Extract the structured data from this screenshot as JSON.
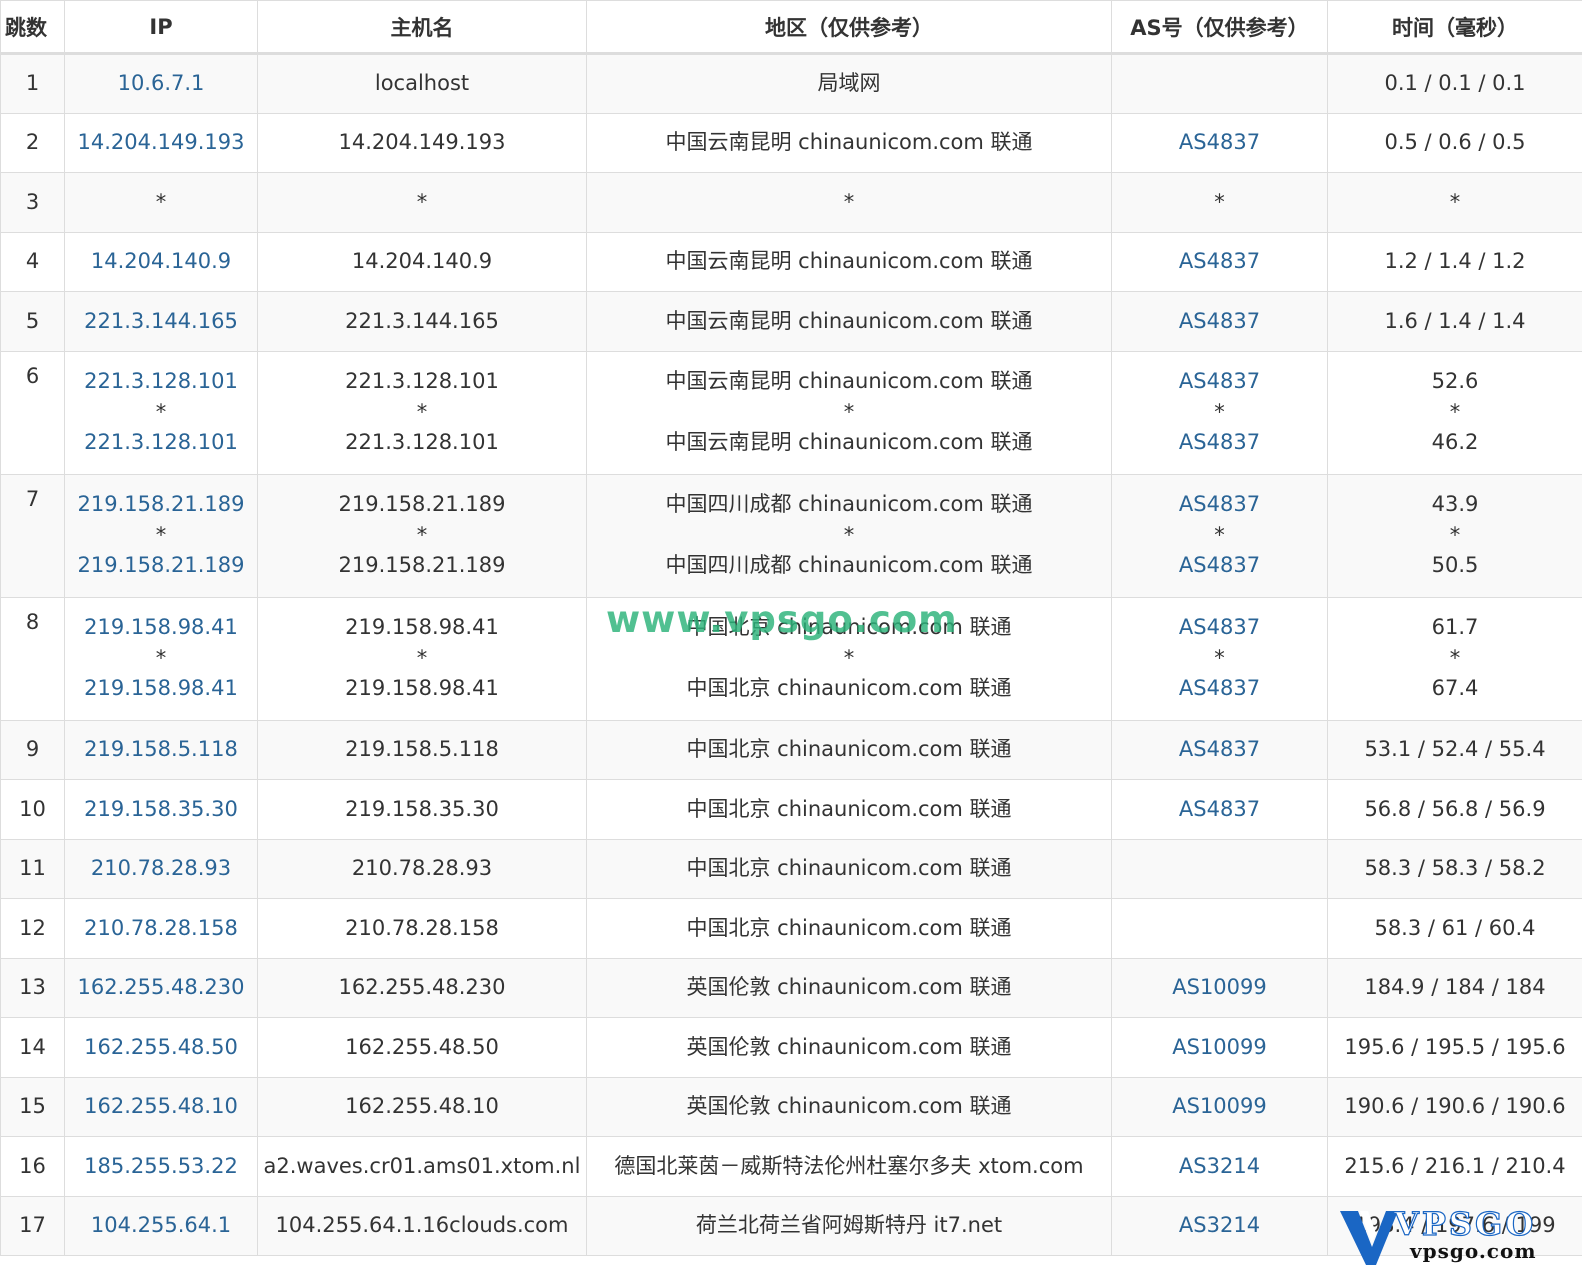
{
  "headers": [
    "跳数",
    "IP",
    "主机名",
    "地区（仅供参考）",
    "AS号（仅供参考）",
    "时间（毫秒）"
  ],
  "hops": [
    {
      "hop": "1",
      "ip": [
        "10.6.7.1"
      ],
      "host": [
        "localhost"
      ],
      "region": [
        "局域网"
      ],
      "as": [
        ""
      ],
      "time": [
        "0.1 / 0.1 / 0.1"
      ]
    },
    {
      "hop": "2",
      "ip": [
        "14.204.149.193"
      ],
      "host": [
        "14.204.149.193"
      ],
      "region": [
        "中国云南昆明 chinaunicom.com 联通"
      ],
      "as": [
        "AS4837"
      ],
      "time": [
        "0.5 / 0.6 / 0.5"
      ]
    },
    {
      "hop": "3",
      "ip": [
        "*"
      ],
      "host": [
        "*"
      ],
      "region": [
        "*"
      ],
      "as": [
        "*"
      ],
      "time": [
        "*"
      ]
    },
    {
      "hop": "4",
      "ip": [
        "14.204.140.9"
      ],
      "host": [
        "14.204.140.9"
      ],
      "region": [
        "中国云南昆明 chinaunicom.com 联通"
      ],
      "as": [
        "AS4837"
      ],
      "time": [
        "1.2 / 1.4 / 1.2"
      ]
    },
    {
      "hop": "5",
      "ip": [
        "221.3.144.165"
      ],
      "host": [
        "221.3.144.165"
      ],
      "region": [
        "中国云南昆明 chinaunicom.com 联通"
      ],
      "as": [
        "AS4837"
      ],
      "time": [
        "1.6 / 1.4 / 1.4"
      ]
    },
    {
      "hop": "6",
      "ip": [
        "221.3.128.101",
        "*",
        "221.3.128.101"
      ],
      "host": [
        "221.3.128.101",
        "*",
        "221.3.128.101"
      ],
      "region": [
        "中国云南昆明 chinaunicom.com 联通",
        "*",
        "中国云南昆明 chinaunicom.com 联通"
      ],
      "as": [
        "AS4837",
        "*",
        "AS4837"
      ],
      "time": [
        "52.6",
        "*",
        "46.2"
      ]
    },
    {
      "hop": "7",
      "ip": [
        "219.158.21.189",
        "*",
        "219.158.21.189"
      ],
      "host": [
        "219.158.21.189",
        "*",
        "219.158.21.189"
      ],
      "region": [
        "中国四川成都 chinaunicom.com 联通",
        "*",
        "中国四川成都 chinaunicom.com 联通"
      ],
      "as": [
        "AS4837",
        "*",
        "AS4837"
      ],
      "time": [
        "43.9",
        "*",
        "50.5"
      ]
    },
    {
      "hop": "8",
      "ip": [
        "219.158.98.41",
        "*",
        "219.158.98.41"
      ],
      "host": [
        "219.158.98.41",
        "*",
        "219.158.98.41"
      ],
      "region": [
        "中国北京 chinaunicom.com 联通",
        "*",
        "中国北京 chinaunicom.com 联通"
      ],
      "as": [
        "AS4837",
        "*",
        "AS4837"
      ],
      "time": [
        "61.7",
        "*",
        "67.4"
      ]
    },
    {
      "hop": "9",
      "ip": [
        "219.158.5.118"
      ],
      "host": [
        "219.158.5.118"
      ],
      "region": [
        "中国北京 chinaunicom.com 联通"
      ],
      "as": [
        "AS4837"
      ],
      "time": [
        "53.1 / 52.4 / 55.4"
      ]
    },
    {
      "hop": "10",
      "ip": [
        "219.158.35.30"
      ],
      "host": [
        "219.158.35.30"
      ],
      "region": [
        "中国北京 chinaunicom.com 联通"
      ],
      "as": [
        "AS4837"
      ],
      "time": [
        "56.8 / 56.8 / 56.9"
      ]
    },
    {
      "hop": "11",
      "ip": [
        "210.78.28.93"
      ],
      "host": [
        "210.78.28.93"
      ],
      "region": [
        "中国北京 chinaunicom.com 联通"
      ],
      "as": [
        ""
      ],
      "time": [
        "58.3 / 58.3 / 58.2"
      ]
    },
    {
      "hop": "12",
      "ip": [
        "210.78.28.158"
      ],
      "host": [
        "210.78.28.158"
      ],
      "region": [
        "中国北京 chinaunicom.com 联通"
      ],
      "as": [
        ""
      ],
      "time": [
        "58.3 / 61 / 60.4"
      ]
    },
    {
      "hop": "13",
      "ip": [
        "162.255.48.230"
      ],
      "host": [
        "162.255.48.230"
      ],
      "region": [
        "英国伦敦 chinaunicom.com 联通"
      ],
      "as": [
        "AS10099"
      ],
      "time": [
        "184.9 / 184 / 184"
      ]
    },
    {
      "hop": "14",
      "ip": [
        "162.255.48.50"
      ],
      "host": [
        "162.255.48.50"
      ],
      "region": [
        "英国伦敦 chinaunicom.com 联通"
      ],
      "as": [
        "AS10099"
      ],
      "time": [
        "195.6 / 195.5 / 195.6"
      ]
    },
    {
      "hop": "15",
      "ip": [
        "162.255.48.10"
      ],
      "host": [
        "162.255.48.10"
      ],
      "region": [
        "英国伦敦 chinaunicom.com 联通"
      ],
      "as": [
        "AS10099"
      ],
      "time": [
        "190.6 / 190.6 / 190.6"
      ]
    },
    {
      "hop": "16",
      "ip": [
        "185.255.53.22"
      ],
      "host": [
        "a2.waves.cr01.ams01.xtom.nl"
      ],
      "region": [
        "德国北莱茵－威斯特法伦州杜塞尔多夫 xtom.com"
      ],
      "as": [
        "AS3214"
      ],
      "time": [
        "215.6 / 216.1 / 210.4"
      ]
    },
    {
      "hop": "17",
      "ip": [
        "104.255.64.1"
      ],
      "host": [
        "104.255.64.1.16clouds.com"
      ],
      "region": [
        "荷兰北荷兰省阿姆斯特丹 it7.net"
      ],
      "as": [
        "AS3214"
      ],
      "time": [
        "198.4 / 197.6 / 199"
      ]
    }
  ],
  "watermark": "www.vpsgo.com",
  "logo": {
    "word": "VPSGO",
    "domain": "vpsgo.com"
  },
  "colors": {
    "link": "#2a6496",
    "border": "#dddddd",
    "stripe": "#f9f9f9",
    "watermark": "#2bb37a",
    "logo_blue": "#1a66c4"
  }
}
